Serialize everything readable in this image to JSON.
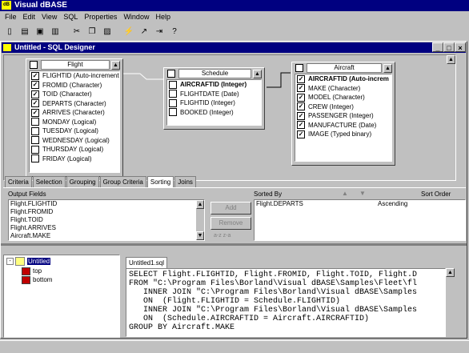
{
  "app": {
    "title": "Visual dBASE",
    "icon": "dbase-app-icon"
  },
  "menu": [
    "File",
    "Edit",
    "View",
    "SQL",
    "Properties",
    "Window",
    "Help"
  ],
  "toolbar": [
    "new-file-icon",
    "open-folder-icon",
    "save-icon",
    "print-icon",
    "cut-icon",
    "copy-icon",
    "paste-icon",
    "run-lightning-icon",
    "chart-icon",
    "export-icon",
    "help-icon"
  ],
  "toolbar_help": "?",
  "designer": {
    "title": "Untitled - SQL Designer"
  },
  "tables": [
    {
      "name": "Flight",
      "fields": [
        {
          "label": "FLIGHTID (Auto-increment)",
          "checked": true
        },
        {
          "label": "FROMID (Character)",
          "checked": true
        },
        {
          "label": "TOID (Character)",
          "checked": true
        },
        {
          "label": "DEPARTS (Character)",
          "checked": true
        },
        {
          "label": "ARRIVES (Character)",
          "checked": true
        },
        {
          "label": "MONDAY (Logical)",
          "checked": false
        },
        {
          "label": "TUESDAY (Logical)",
          "checked": false
        },
        {
          "label": "WEDNESDAY (Logical)",
          "checked": false
        },
        {
          "label": "THURSDAY (Logical)",
          "checked": false
        },
        {
          "label": "FRIDAY (Logical)",
          "checked": false
        }
      ]
    },
    {
      "name": "Schedule",
      "fields": [
        {
          "label": "AIRCRAFTID (Integer)",
          "checked": false
        },
        {
          "label": "FLIGHTDATE (Date)",
          "checked": false
        },
        {
          "label": "FLIGHTID (Integer)",
          "checked": false
        },
        {
          "label": "BOOKED (Integer)",
          "checked": false
        }
      ]
    },
    {
      "name": "Aircraft",
      "fields": [
        {
          "label": "AIRCRAFTID (Auto-increm",
          "checked": true
        },
        {
          "label": "MAKE (Character)",
          "checked": true
        },
        {
          "label": "MODEL (Character)",
          "checked": true
        },
        {
          "label": "CREW (Integer)",
          "checked": true
        },
        {
          "label": "PASSENGER (Integer)",
          "checked": true
        },
        {
          "label": "MANUFACTURE (Date)",
          "checked": true
        },
        {
          "label": "IMAGE (Typed binary)",
          "checked": true
        }
      ]
    }
  ],
  "tabs": [
    "Criteria",
    "Selection",
    "Grouping",
    "Group Criteria",
    "Sorting",
    "Joins"
  ],
  "active_tab": "Sorting",
  "sorting": {
    "output_label": "Output Fields",
    "output_fields": [
      "Flight.FLIGHTID",
      "Flight.FROMID",
      "Flight.TOID",
      "Flight.ARRIVES",
      "Aircraft.MAKE"
    ],
    "add_label": "Add",
    "remove_label": "Remove",
    "az_label": "a-z  z-a",
    "sorted_by_label": "Sorted By",
    "sort_order_label": "Sort Order",
    "sorted": [
      {
        "field": "Flight.DEPARTS",
        "order": "Ascending"
      }
    ]
  },
  "tree": {
    "root": "Untitled",
    "children": [
      "top",
      "bottom"
    ]
  },
  "sql_tab": "Untitled1.sql",
  "sql_lines": [
    "SELECT Flight.FLIGHTID, Flight.FROMID, Flight.TOID, Flight.D",
    "FROM \"C:\\Program Files\\Borland\\Visual dBASE\\Samples\\Fleet\\fl",
    "   INNER JOIN \"C:\\Program Files\\Borland\\Visual dBASE\\Samples",
    "   ON  (Flight.FLIGHTID = Schedule.FLIGHTID)",
    "   INNER JOIN \"C:\\Program Files\\Borland\\Visual dBASE\\Samples",
    "   ON  (Schedule.AIRCRAFTID = Aircraft.AIRCRAFTID)",
    "GROUP BY Aircraft.MAKE"
  ]
}
